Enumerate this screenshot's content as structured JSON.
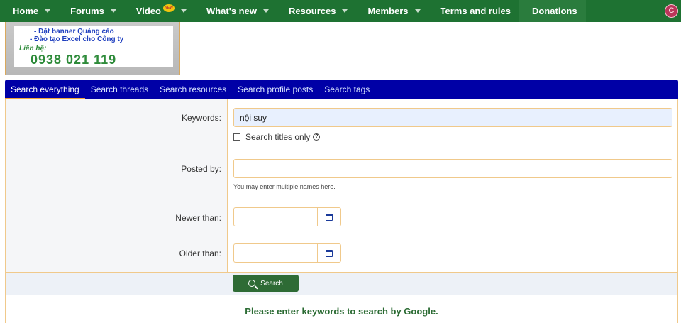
{
  "nav": {
    "items": [
      {
        "label": "Home"
      },
      {
        "label": "Forums"
      },
      {
        "label": "Video"
      },
      {
        "label": "What's new"
      },
      {
        "label": "Resources"
      },
      {
        "label": "Members"
      },
      {
        "label": "Terms and rules"
      },
      {
        "label": "Donations"
      }
    ],
    "video_badge": "NEW",
    "avatar_letter": "C"
  },
  "banner": {
    "line1": "- Đặt banner Quảng cáo",
    "line2": "- Đào tạo Excel cho Công ty",
    "contact": "Liên hệ:",
    "phone": "0938 021 119"
  },
  "tabs": [
    {
      "label": "Search everything",
      "active": true
    },
    {
      "label": "Search threads"
    },
    {
      "label": "Search resources"
    },
    {
      "label": "Search profile posts"
    },
    {
      "label": "Search tags"
    }
  ],
  "form": {
    "keywords_label": "Keywords:",
    "keywords_value": "nội suy",
    "titles_only_label": "Search titles only",
    "posted_by_label": "Posted by:",
    "posted_by_hint": "You may enter multiple names here.",
    "newer_than_label": "Newer than:",
    "older_than_label": "Older than:",
    "search_button": "Search"
  },
  "google_note": "Please enter keywords to search by Google.",
  "colors": {
    "nav_green": "#1e7232",
    "tab_blue": "#0000a6",
    "accent_orange": "#f1a33c",
    "button_green": "#2e6b35"
  }
}
